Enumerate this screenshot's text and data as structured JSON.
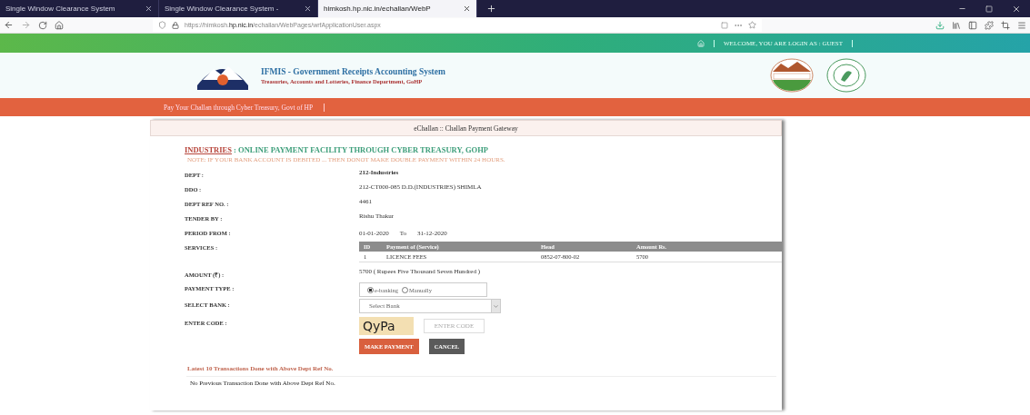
{
  "browser": {
    "tabs": [
      {
        "title": "Single Window Clearance System",
        "selected": false
      },
      {
        "title": "Single Window Clearance System -",
        "selected": false
      },
      {
        "title": "himkosh.hp.nic.in/echallan/WebP",
        "selected": true
      }
    ],
    "address": {
      "prefix": "https://himkosh.",
      "domain": "hp.nic.in",
      "suffix": "/echallan/WebPages/wrfApplicationUser.aspx"
    }
  },
  "topbar": {
    "welcome": "WELCOME, YOU ARE LOGIN AS : GUEST"
  },
  "header": {
    "title": "IFMIS - Government Receipts Accounting System",
    "subtitle": "Treasuries, Accounts and Lotteries, Finance Department, GoHP"
  },
  "nav": {
    "link": "Pay Your Challan through Cyber Treasury, Govt of HP"
  },
  "panel": {
    "title": "eChallan :: Challan Payment Gateway",
    "heading_dept": "INDUSTRIES",
    "heading_rest": ": ONLINE PAYMENT FACILITY THROUGH CYBER TREASURY, GOHP",
    "note": "NOTE: IF YOUR BANK ACCOUNT IS DEBITED ... THEN DONOT MAKE DOUBLE PAYMENT WITHIN 24 HOURS.",
    "rows": [
      {
        "kind": "text",
        "label": "DEPT :",
        "value": "212-Industries",
        "bold": true
      },
      {
        "kind": "text",
        "label": "DDO :",
        "value": "212-CT000-085 D.D.(INDUSTRIES) SHIMLA",
        "bold": false
      },
      {
        "kind": "text",
        "label": "DEPT REF NO. :",
        "value": "4461",
        "bold": false
      },
      {
        "kind": "text",
        "label": "TENDER BY :",
        "value": "Rishu Thakur",
        "bold": false
      },
      {
        "kind": "period",
        "label": "PERIOD FROM :",
        "from": "01-01-2020",
        "to_label": "To",
        "to": "31-12-2020"
      },
      {
        "kind": "table",
        "label": "SERVICES :",
        "columns": [
          "ID",
          "Payment of (Service)",
          "Head",
          "Amount Rs."
        ],
        "rows": [
          [
            "1",
            "LICENCE FEES",
            "0852-07-800-02",
            "5700"
          ]
        ]
      },
      {
        "kind": "text",
        "label": "AMOUNT (₹) :",
        "value": "5700 ( Rupees Five Thousand Seven Hundred )",
        "bold": false
      },
      {
        "kind": "radio",
        "label": "PAYMENT TYPE :",
        "options": [
          {
            "label": "e-banking",
            "selected": true
          },
          {
            "label": "Manually",
            "selected": false
          }
        ]
      },
      {
        "kind": "select",
        "label": "SELECT BANK :",
        "value": "Select Bank"
      },
      {
        "kind": "captcha",
        "label": "ENTER CODE :",
        "captcha": "QyPa",
        "placeholder": "ENTER CODE"
      }
    ],
    "buttons": [
      {
        "label": "MAKE PAYMENT",
        "kind": "primary"
      },
      {
        "label": "CANCEL",
        "kind": "secondary"
      }
    ],
    "latest_title": "Latest 10 Transactions Done with Above Dept Ref No.",
    "latest_empty": "No Previous Transaction Done with Above Dept Ref No."
  }
}
